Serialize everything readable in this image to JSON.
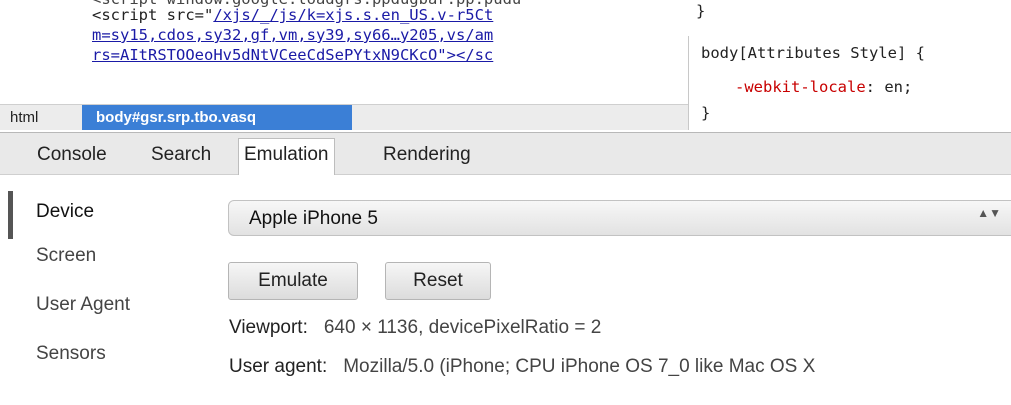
{
  "source": {
    "line0": "<script window.google.loadgrs.ppdugbar.pp.pudu",
    "line1_prefix": "<script src=\"",
    "line1_link": "/xjs/_/js/k=xjs.s.en_US.v-r5Ct",
    "line2_link": "m=sy15,cdos,sy32,gf,vm,sy39,sy66…y205,vs/am",
    "line3_link": "rs=AItRSTOOeoHv5dNtVCeeCdSePYtxN9CKcO\"></sc",
    "close_brace_top": "}"
  },
  "styles": {
    "selector": "body[Attributes Style] {",
    "prop_name": "-webkit-locale",
    "prop_value": ": en;",
    "close_brace": "}"
  },
  "breadcrumb": {
    "items": [
      "html",
      "body#gsr.srp.tbo.vasq"
    ]
  },
  "drawer": {
    "tabs": [
      "Console",
      "Search",
      "Emulation",
      "Rendering"
    ],
    "active_tab": "Emulation",
    "side_nav": [
      "Device",
      "Screen",
      "User Agent",
      "Sensors"
    ],
    "active_nav": "Device",
    "device": {
      "selected": "Apple iPhone 5",
      "arrows": "▲▼"
    },
    "buttons": {
      "emulate": "Emulate",
      "reset": "Reset"
    },
    "viewport": {
      "label": "Viewport:",
      "value": "640 × 1136, devicePixelRatio = 2"
    },
    "user_agent": {
      "label": "User agent:",
      "value": "Mozilla/5.0 (iPhone; CPU iPhone OS 7_0 like Mac OS X"
    }
  },
  "colors": {
    "breadcrumb_active_bg": "#3b7fd6",
    "link": "#1a1aa6",
    "css_property": "#c80000"
  }
}
